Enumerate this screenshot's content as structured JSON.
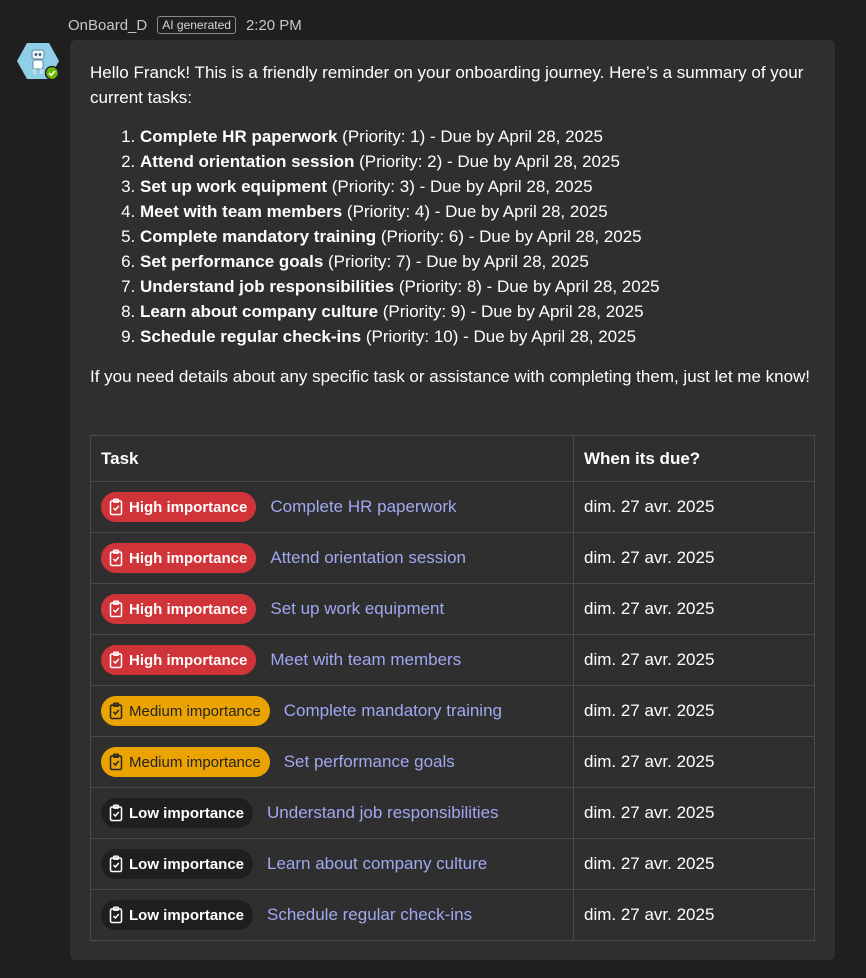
{
  "header": {
    "sender": "OnBoard_D",
    "ai_tag": "AI generated",
    "time": "2:20 PM"
  },
  "message": {
    "intro": "Hello Franck! This is a friendly reminder on your onboarding journey. Here’s a summary of your current tasks:",
    "list": [
      {
        "title": "Complete HR paperwork",
        "rest": " (Priority: 1) - Due by April 28, 2025"
      },
      {
        "title": "Attend orientation session",
        "rest": " (Priority: 2) - Due by April 28, 2025"
      },
      {
        "title": "Set up work equipment",
        "rest": " (Priority: 3) - Due by April 28, 2025"
      },
      {
        "title": "Meet with team members",
        "rest": " (Priority: 4) - Due by April 28, 2025"
      },
      {
        "title": "Complete mandatory training",
        "rest": " (Priority: 6) - Due by April 28, 2025"
      },
      {
        "title": "Set performance goals",
        "rest": " (Priority: 7) - Due by April 28, 2025"
      },
      {
        "title": "Understand job responsibilities",
        "rest": " (Priority: 8) - Due by April 28, 2025"
      },
      {
        "title": "Learn about company culture",
        "rest": " (Priority: 9) - Due by April 28, 2025"
      },
      {
        "title": "Schedule regular check-ins",
        "rest": " (Priority: 10) - Due by April 28, 2025"
      }
    ],
    "outro": "If you need details about any specific task or assistance with completing them, just let me know!"
  },
  "table": {
    "headers": [
      "Task",
      "When its due?"
    ],
    "rows": [
      {
        "badge": "High importance",
        "level": "high",
        "task": "Complete HR paperwork",
        "due": "dim. 27 avr. 2025"
      },
      {
        "badge": "High importance",
        "level": "high",
        "task": "Attend orientation session",
        "due": "dim. 27 avr. 2025"
      },
      {
        "badge": "High importance",
        "level": "high",
        "task": "Set up work equipment",
        "due": "dim. 27 avr. 2025"
      },
      {
        "badge": "High importance",
        "level": "high",
        "task": "Meet with team members",
        "due": "dim. 27 avr. 2025"
      },
      {
        "badge": "Medium importance",
        "level": "medium",
        "task": "Complete mandatory training",
        "due": "dim. 27 avr. 2025"
      },
      {
        "badge": "Medium importance",
        "level": "medium",
        "task": "Set performance goals",
        "due": "dim. 27 avr. 2025"
      },
      {
        "badge": "Low importance",
        "level": "low",
        "task": "Understand job responsibilities",
        "due": "dim. 27 avr. 2025"
      },
      {
        "badge": "Low importance",
        "level": "low",
        "task": "Learn about company culture",
        "due": "dim. 27 avr. 2025"
      },
      {
        "badge": "Low importance",
        "level": "low",
        "task": "Schedule regular check-ins",
        "due": "dim. 27 avr. 2025"
      }
    ]
  },
  "colors": {
    "high": "#d13438",
    "medium": "#eaa300",
    "low": "#1f1f1f",
    "link": "#a0a8f0",
    "status": "#6bb700"
  },
  "icons": {
    "avatar": "bot-avatar-icon",
    "status": "available-check-icon",
    "badge": "clipboard-check-icon"
  }
}
